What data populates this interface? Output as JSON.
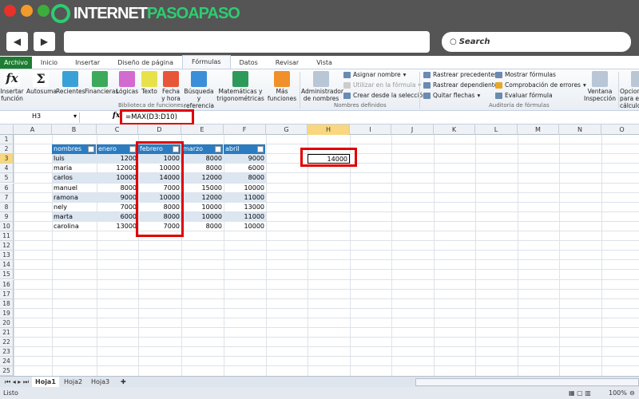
{
  "browser": {
    "logo_text_a": "INTERNET",
    "logo_text_b": "PASOAPASO",
    "back": "◀",
    "forward": "▶",
    "search_placeholder": "Search",
    "colors": {
      "red": "#e8312a",
      "orange": "#f39a2b",
      "green": "#3cae3c",
      "brand": "#2ecc71"
    }
  },
  "ribbon": {
    "tabs": [
      "Archivo",
      "Inicio",
      "Insertar",
      "Diseño de página",
      "Fórmulas",
      "Datos",
      "Revisar",
      "Vista"
    ],
    "active_tab": "Fórmulas",
    "library_buttons": [
      {
        "label": "Insertar función",
        "icon": "fx-icon",
        "color": "#ffffff"
      },
      {
        "label": "Autosuma",
        "icon": "sigma-icon",
        "color": "#ffffff"
      },
      {
        "label": "Recientes",
        "icon": "book-star-icon",
        "color": "#3aa0d8"
      },
      {
        "label": "Financieras",
        "icon": "book-money-icon",
        "color": "#3caa5a"
      },
      {
        "label": "Lógicas",
        "icon": "book-question-icon",
        "color": "#d36ad0"
      },
      {
        "label": "Texto",
        "icon": "book-text-icon",
        "color": "#e8e24a"
      },
      {
        "label": "Fecha y hora",
        "icon": "book-calendar-icon",
        "color": "#e8563a"
      },
      {
        "label": "Búsqueda y referencia",
        "icon": "book-search-icon",
        "color": "#3a8fd8"
      },
      {
        "label": "Matemáticas y trigonométricas",
        "icon": "book-theta-icon",
        "color": "#2e9a5a"
      },
      {
        "label": "Más funciones",
        "icon": "books-icon",
        "color": "#f0902a"
      }
    ],
    "group_library": "Biblioteca de funciones",
    "names": {
      "manager": "Administrador de nombres",
      "assign": "Asignar nombre",
      "use": "Utilizar en la fórmula",
      "create": "Crear desde la selección",
      "group": "Nombres definidos"
    },
    "audit": {
      "precedents": "Rastrear precedentes",
      "dependents": "Rastrear dependientes",
      "remove": "Quitar flechas",
      "show": "Mostrar fórmulas",
      "errors": "Comprobación de errores",
      "evaluate": "Evaluar fórmula",
      "watch": "Ventana Inspección",
      "group": "Auditoría de fórmulas"
    },
    "calc": {
      "options": "Opciones para el cálculo"
    }
  },
  "formula_bar": {
    "name_box": "H3",
    "fx": "fx",
    "formula": "=MAX(D3:D10)"
  },
  "columns": [
    "A",
    "B",
    "C",
    "D",
    "E",
    "F",
    "G",
    "H",
    "I",
    "J",
    "K",
    "L",
    "M",
    "N",
    "O"
  ],
  "selected_column": "H",
  "selected_row": 3,
  "row_count": 25,
  "table": {
    "headers": [
      "nombres",
      "enero",
      "febrero",
      "marzo",
      "abril"
    ],
    "rows": [
      [
        "luis",
        "1200",
        "1000",
        "8000",
        "9000"
      ],
      [
        "maria",
        "12000",
        "10000",
        "8000",
        "6000"
      ],
      [
        "carlos",
        "10000",
        "14000",
        "12000",
        "8000"
      ],
      [
        "manuel",
        "8000",
        "7000",
        "15000",
        "10000"
      ],
      [
        "ramona",
        "9000",
        "10000",
        "12000",
        "11000"
      ],
      [
        "nely",
        "7000",
        "8000",
        "10000",
        "13000"
      ],
      [
        "marta",
        "6000",
        "8000",
        "10000",
        "11000"
      ],
      [
        "carolina",
        "13000",
        "7000",
        "8000",
        "10000"
      ]
    ]
  },
  "result_cell": {
    "ref": "H3",
    "value": "14000"
  },
  "sheets": [
    "Hoja1",
    "Hoja2",
    "Hoja3"
  ],
  "active_sheet": "Hoja1",
  "status": {
    "text": "Listo",
    "zoom": "100%"
  }
}
